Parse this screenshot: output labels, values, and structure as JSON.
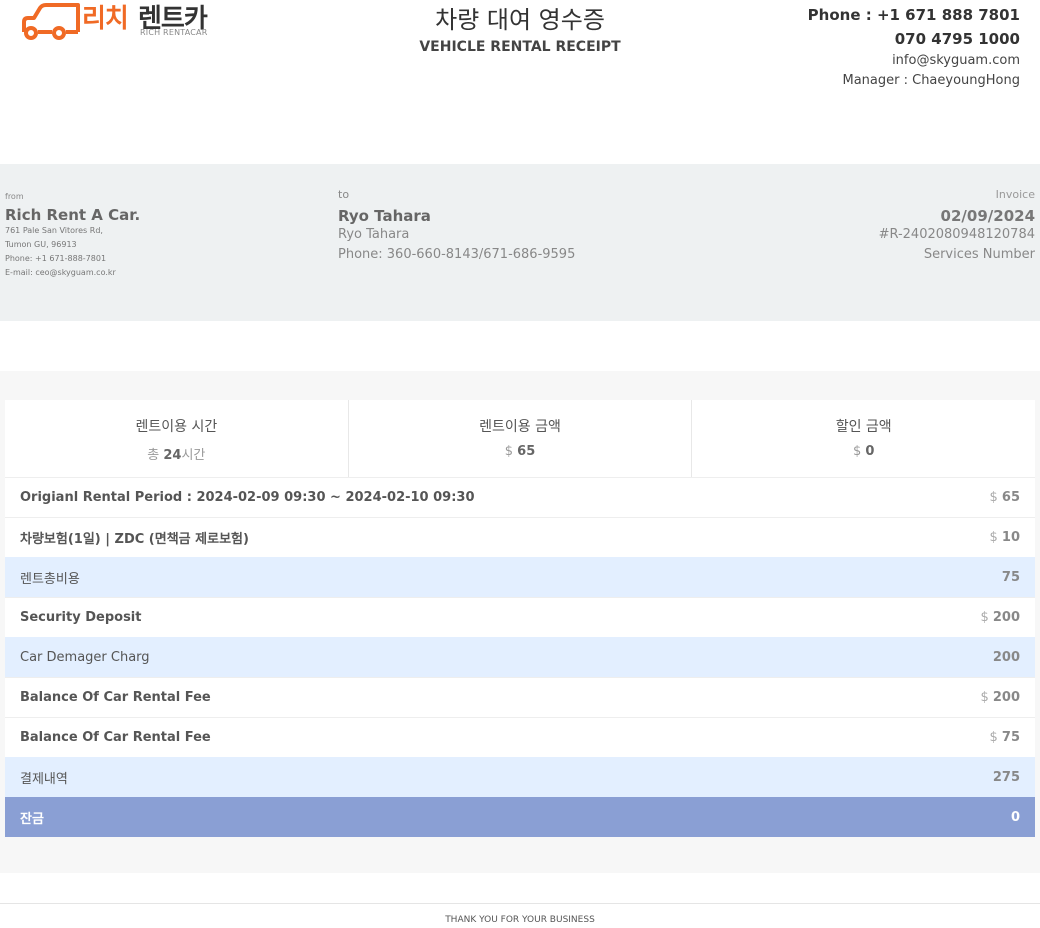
{
  "logo": {
    "text_kr_1": "리치",
    "text_kr_2": "렌트카",
    "text_en": "RICH RENTACAR"
  },
  "header": {
    "title_kr": "차량 대여 영수증",
    "title_en": "VEHICLE RENTAL RECEIPT"
  },
  "contact": {
    "phone": "Phone : +1 671 888 7801",
    "phone2": "070 4795 1000",
    "email": "info@skyguam.com",
    "manager": "Manager : ChaeyoungHong"
  },
  "from": {
    "label": "from",
    "name": "Rich Rent A Car.",
    "address1": "761 Pale San Vitores Rd,",
    "address2": "Tumon GU, 96913",
    "phone": "Phone: +1 671-888-7801",
    "email": "E-mail: ceo@skyguam.co.kr"
  },
  "to": {
    "label": "to",
    "name": "Ryo Tahara",
    "name2": "Ryo Tahara",
    "phone": "Phone: 360-660-8143/671-686-9595"
  },
  "invoice": {
    "label": "Invoice",
    "date": "02/09/2024",
    "number": "#R-2402080948120784",
    "services": "Services Number"
  },
  "summary": [
    {
      "label": "렌트이용 시간",
      "prefix": "총 ",
      "value": "24",
      "suffix": "시간"
    },
    {
      "label": "렌트이용 금액",
      "prefix": "$ ",
      "value": "65",
      "suffix": ""
    },
    {
      "label": "할인 금액",
      "prefix": "$ ",
      "value": "0",
      "suffix": ""
    }
  ],
  "rows": [
    {
      "label": "Origianl Rental Period : 2024-02-09 09:30 ~ 2024-02-10 09:30",
      "currency": "$ ",
      "value": "65"
    },
    {
      "label": "차량보험(1일) | ZDC (면책금 제로보험)",
      "currency": "$ ",
      "value": "10"
    },
    {
      "label": "렌트총비용",
      "currency": "",
      "value": "75"
    },
    {
      "label": "Security Deposit",
      "currency": "$ ",
      "value": "200"
    },
    {
      "label": "Car Demager Charg",
      "currency": "",
      "value": "200"
    },
    {
      "label": "Balance Of Car Rental Fee",
      "currency": "$ ",
      "value": "200"
    },
    {
      "label": "Balance Of Car Rental Fee",
      "currency": "$ ",
      "value": "75"
    },
    {
      "label": "결제내역",
      "currency": "",
      "value": "275"
    },
    {
      "label": "잔금",
      "currency": "",
      "value": "0"
    }
  ],
  "footer": {
    "text": "THANK YOU FOR YOUR BUSINESS"
  },
  "colors": {
    "brand_orange": "#f06a25",
    "highlight_row": "#e3efff",
    "total_row": "#8a9fd4"
  }
}
